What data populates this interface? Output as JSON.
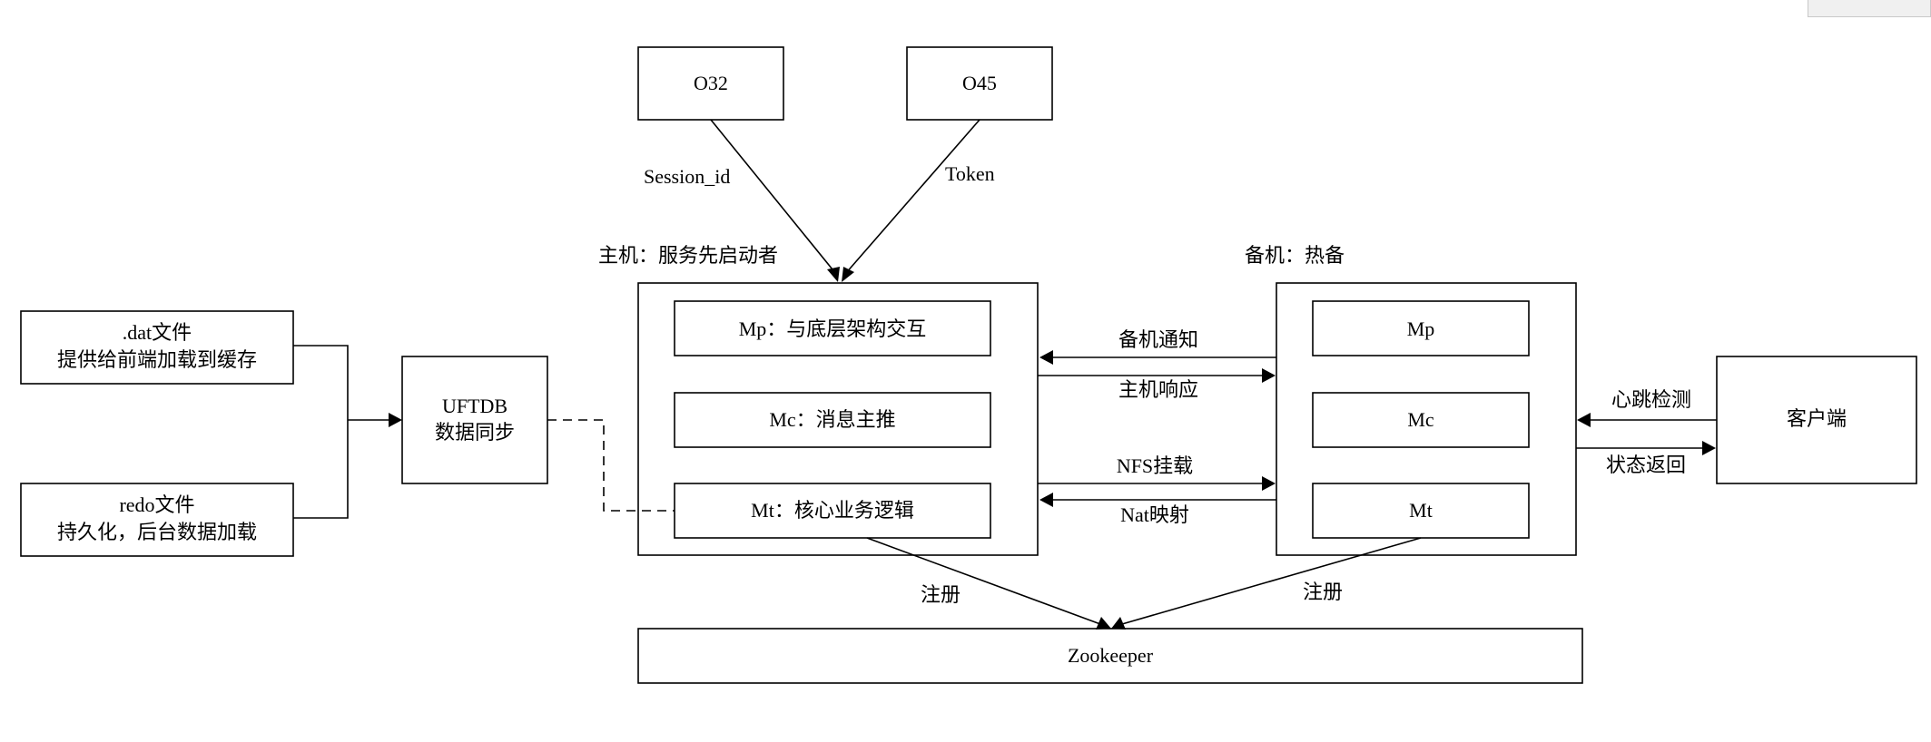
{
  "nodes": {
    "o32": "O32",
    "o45": "O45",
    "dat_file": {
      "line1": ".dat文件",
      "line2": "提供给前端加载到缓存"
    },
    "redo_file": {
      "line1": "redo文件",
      "line2": "持久化，后台数据加载"
    },
    "uftdb": {
      "line1": "UFTDB",
      "line2": "数据同步"
    },
    "primary": {
      "title": "主机：服务先启动者",
      "mp": "Mp：与底层架构交互",
      "mc": "Mc：消息主推",
      "mt": "Mt：核心业务逻辑"
    },
    "standby": {
      "title": "备机：热备",
      "mp": "Mp",
      "mc": "Mc",
      "mt": "Mt"
    },
    "client": "客户端",
    "zookeeper": "Zookeeper"
  },
  "edges": {
    "session_id": "Session_id",
    "token": "Token",
    "standby_notify": "备机通知",
    "primary_response": "主机响应",
    "nfs_mount": "NFS挂载",
    "nat_mapping": "Nat映射",
    "heartbeat": "心跳检测",
    "status_return": "状态返回",
    "register_primary": "注册",
    "register_standby": "注册"
  }
}
